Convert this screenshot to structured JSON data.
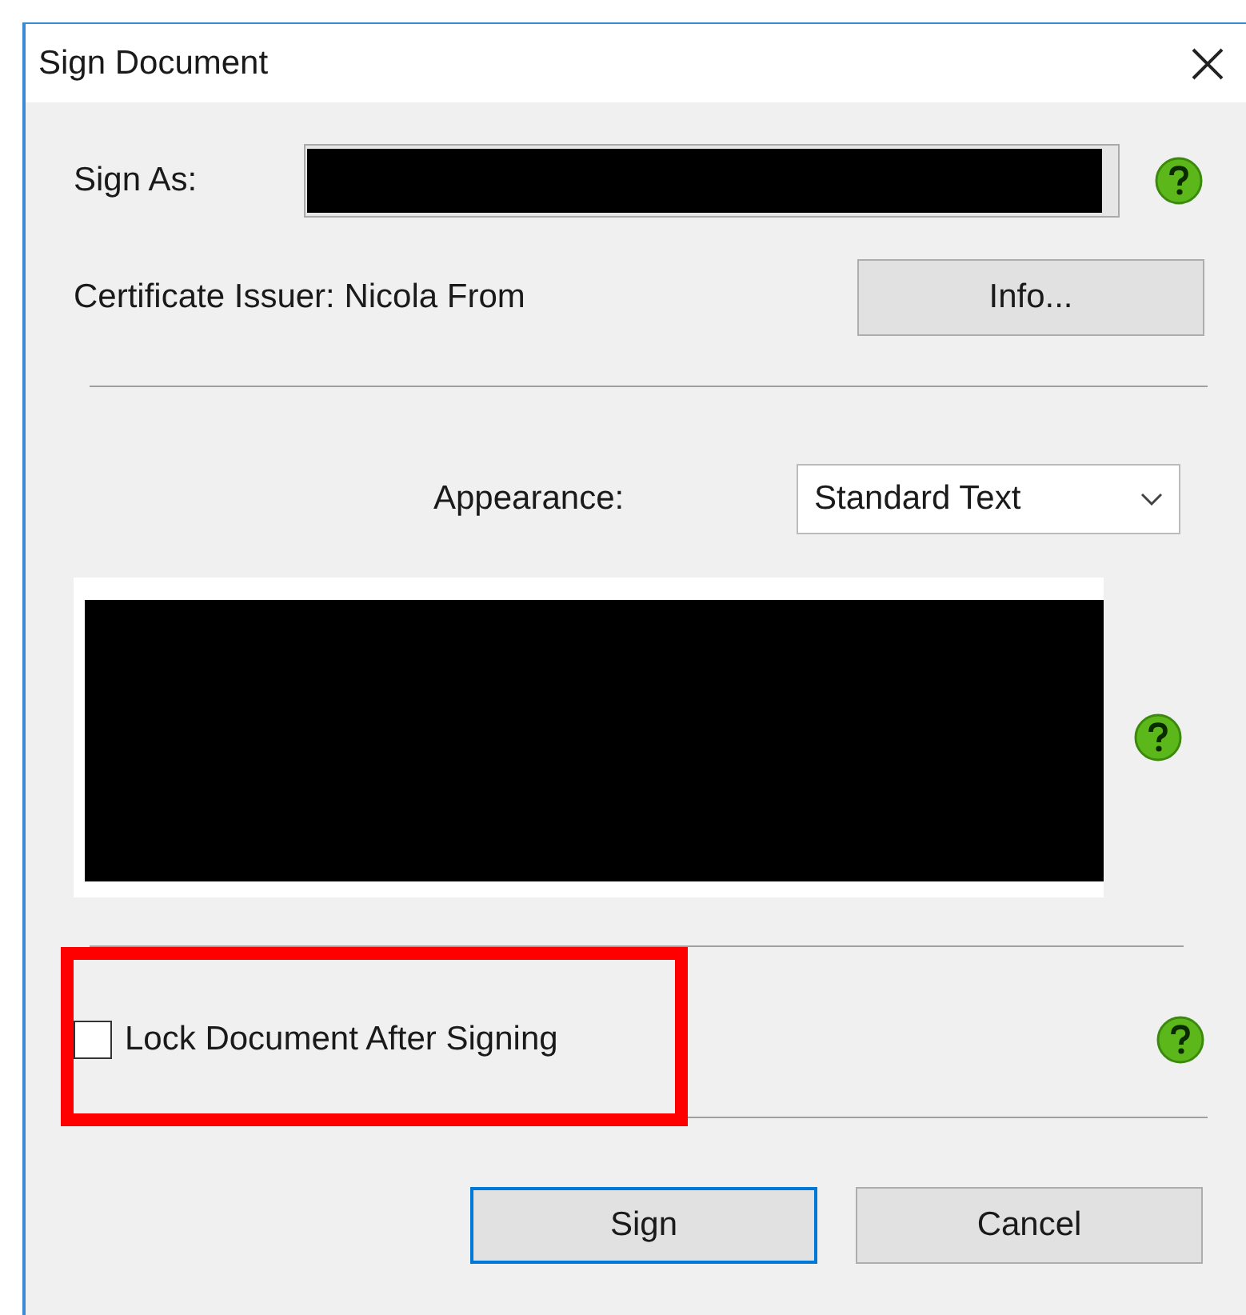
{
  "window": {
    "title": "Sign Document"
  },
  "sign_as": {
    "label": "Sign As:"
  },
  "certificate": {
    "issuer": "Certificate Issuer: Nicola From",
    "button": "Info..."
  },
  "appearance": {
    "label": "Appearance:",
    "value": "Standard Text"
  },
  "lock": {
    "label": "Lock Document After Signing",
    "checked": false,
    "highlighted": true
  },
  "buttons": [
    {
      "label": "Sign",
      "default": true
    },
    {
      "label": "Cancel",
      "default": false
    }
  ]
}
